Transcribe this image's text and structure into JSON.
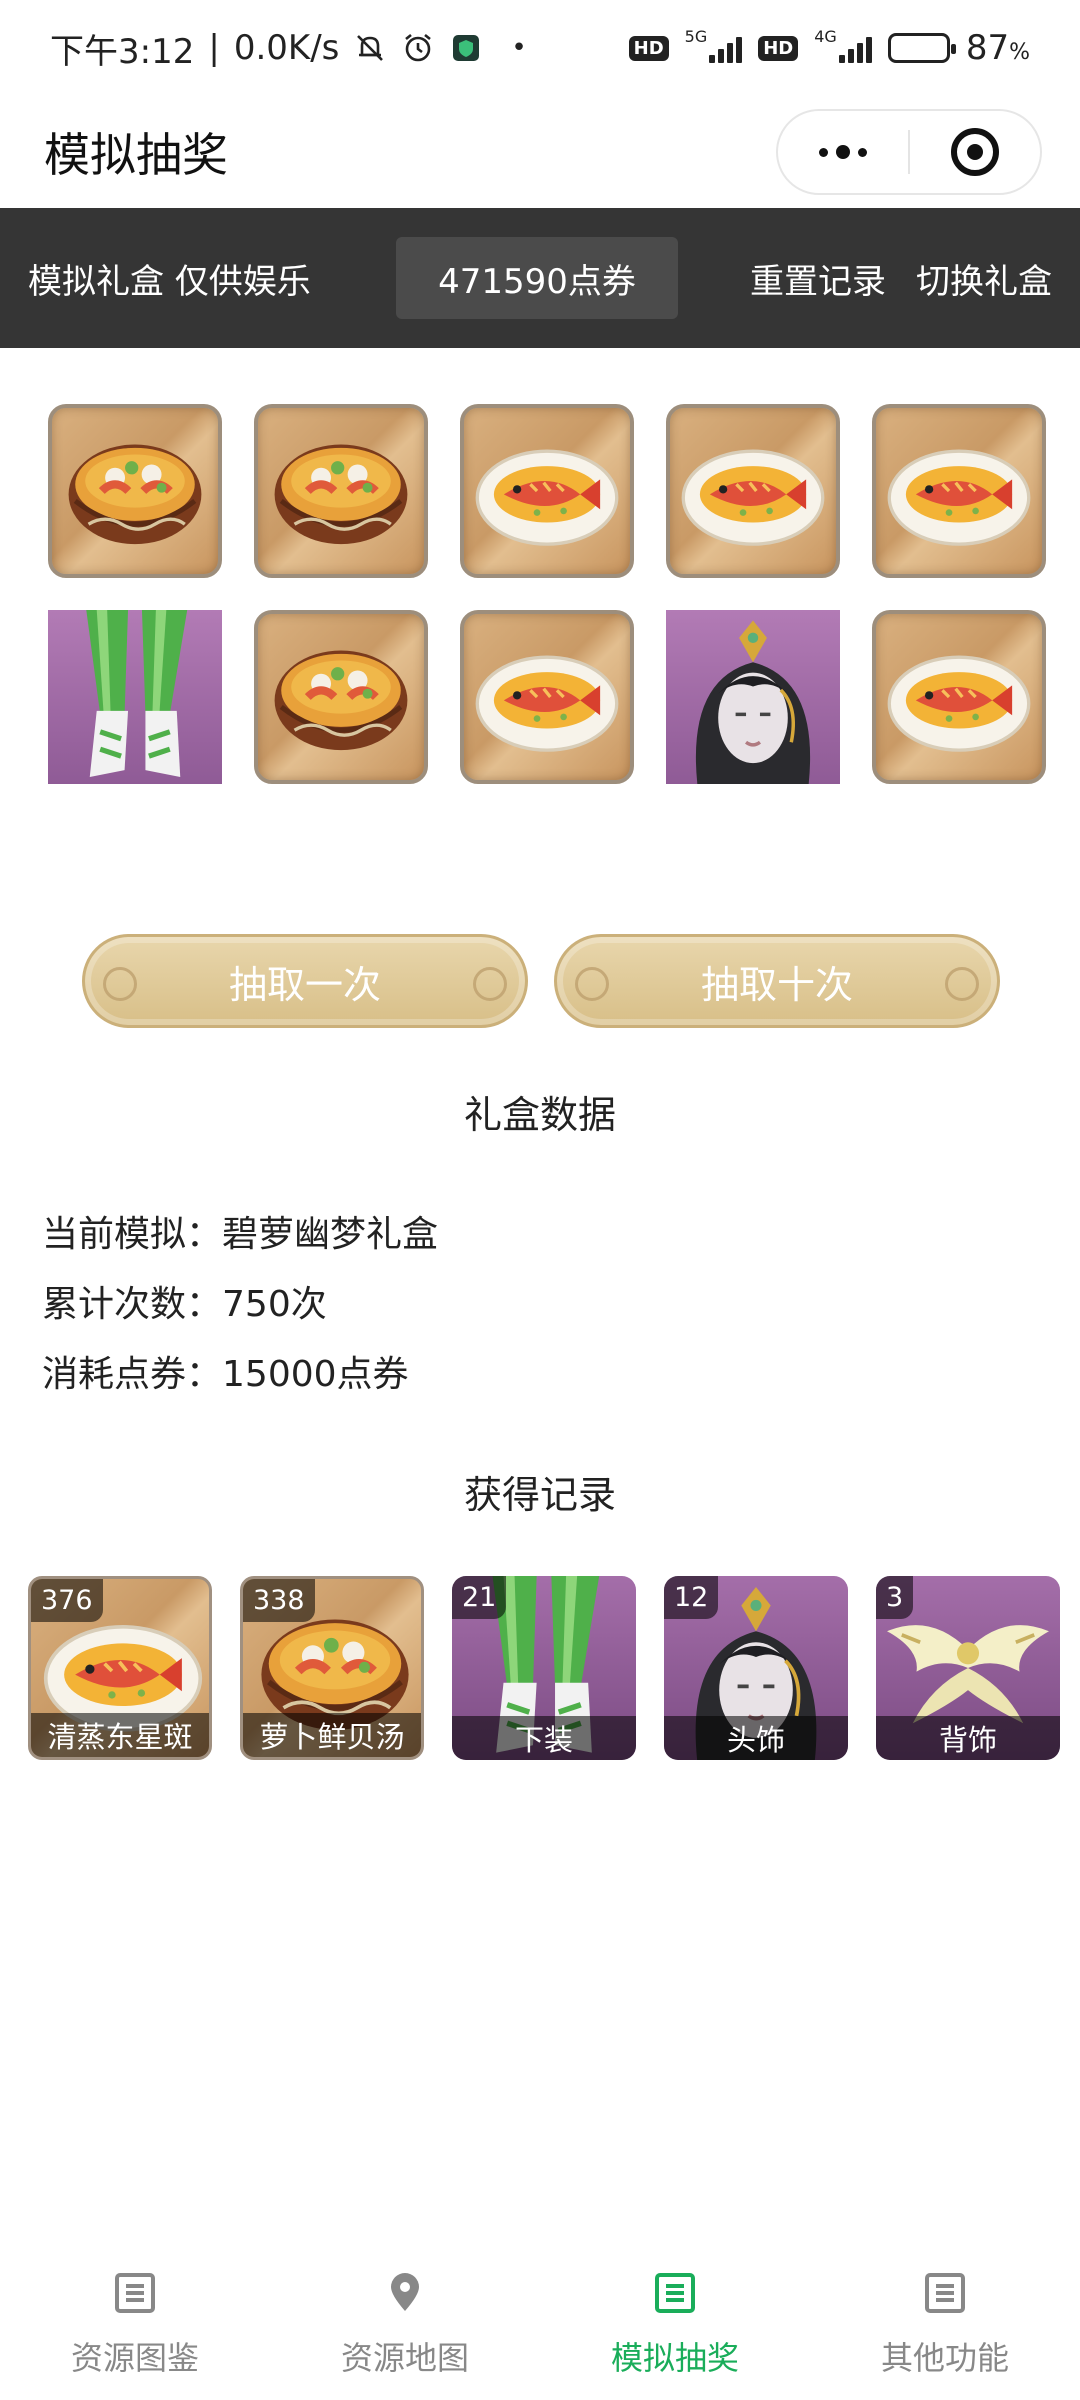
{
  "status_bar": {
    "time": "下午3:12",
    "speed": "0.0K/s",
    "net1": "5G",
    "net2": "4G",
    "hd": "HD",
    "battery_pct": "87",
    "battery_unit": "%",
    "battery_level": 0.87
  },
  "titlebar": {
    "title": "模拟抽奖"
  },
  "header": {
    "disclaimer": "模拟礼盒 仅供娱乐",
    "points": "471590点券",
    "reset_label": "重置记录",
    "switch_label": "切换礼盒"
  },
  "rewards": [
    {
      "kind": "soup",
      "icon": "radish-shellfish-soup-icon"
    },
    {
      "kind": "soup",
      "icon": "radish-shellfish-soup-icon"
    },
    {
      "kind": "fish",
      "icon": "steamed-grouper-icon"
    },
    {
      "kind": "fish",
      "icon": "steamed-grouper-icon"
    },
    {
      "kind": "fish",
      "icon": "steamed-grouper-icon"
    },
    {
      "kind": "pants",
      "icon": "pants-costume-icon"
    },
    {
      "kind": "soup",
      "icon": "radish-shellfish-soup-icon"
    },
    {
      "kind": "fish",
      "icon": "steamed-grouper-icon"
    },
    {
      "kind": "head",
      "icon": "headwear-costume-icon"
    },
    {
      "kind": "fish",
      "icon": "steamed-grouper-icon"
    }
  ],
  "buttons": {
    "draw_once": "抽取一次",
    "draw_ten": "抽取十次"
  },
  "box_data": {
    "title": "礼盒数据",
    "current_label": "当前模拟：",
    "current_value": "碧萝幽梦礼盒",
    "count_label": "累计次数：",
    "count_value": "750次",
    "cost_label": "消耗点券：",
    "cost_value": "15000点券"
  },
  "records": {
    "title": "获得记录",
    "items": [
      {
        "count": "376",
        "label": "清蒸东星斑",
        "kind": "fish"
      },
      {
        "count": "338",
        "label": "萝卜鲜贝汤",
        "kind": "soup"
      },
      {
        "count": "21",
        "label": "下装",
        "kind": "pants"
      },
      {
        "count": "12",
        "label": "头饰",
        "kind": "head"
      },
      {
        "count": "3",
        "label": "背饰",
        "kind": "back"
      }
    ]
  },
  "tabbar": {
    "tabs": [
      {
        "label": "资源图鉴",
        "icon": "book-icon",
        "active": false
      },
      {
        "label": "资源地图",
        "icon": "map-pin-icon",
        "active": false
      },
      {
        "label": "模拟抽奖",
        "icon": "lottery-icon",
        "active": true
      },
      {
        "label": "其他功能",
        "icon": "more-functions-icon",
        "active": false
      }
    ],
    "active_color": "#1aad5a",
    "inactive_color": "#888888"
  },
  "colors": {
    "header_bg": "#353535",
    "button_gold": "#d8bf88",
    "accent_green": "#1aad5a"
  }
}
